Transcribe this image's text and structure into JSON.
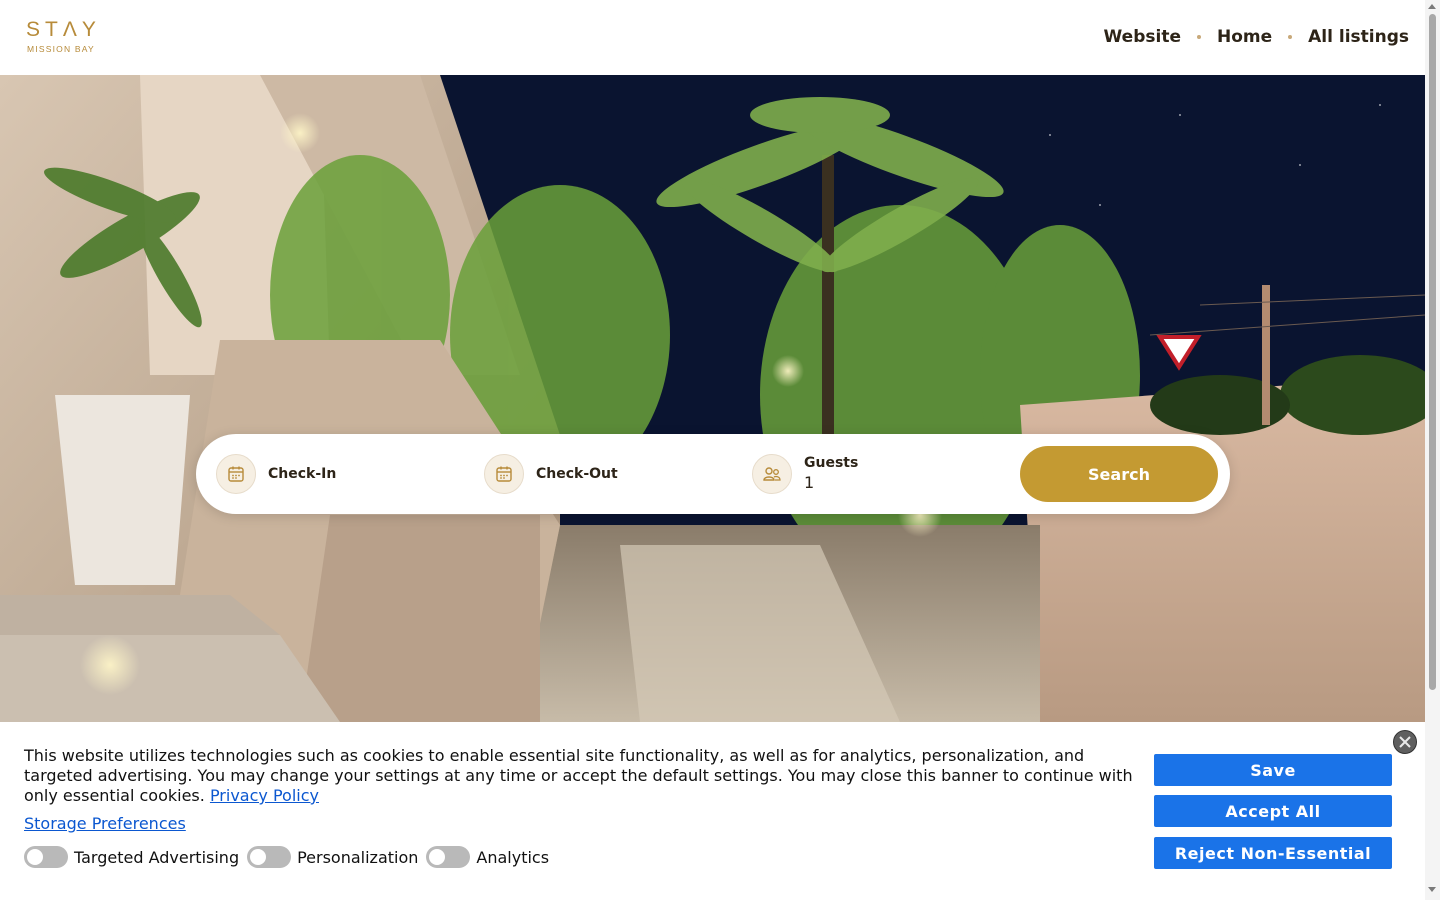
{
  "header": {
    "logo_main": "STΛY",
    "logo_sub": "MISSION BAY",
    "nav": [
      {
        "label": "Website"
      },
      {
        "label": "Home"
      },
      {
        "label": "All listings"
      }
    ]
  },
  "search": {
    "checkin_label": "Check-In",
    "checkout_label": "Check-Out",
    "guests_label": "Guests",
    "guests_value": "1",
    "search_button": "Search"
  },
  "cookie_banner": {
    "text": "This website utilizes technologies such as cookies to enable essential site functionality, as well as for analytics, personalization, and targeted advertising. You may change your settings at any time or accept the default settings. You may close this banner to continue with only essential cookies.",
    "privacy_link": "Privacy Policy",
    "storage_link": "Storage Preferences",
    "toggles": [
      {
        "label": "Targeted Advertising",
        "on": false
      },
      {
        "label": "Personalization",
        "on": false
      },
      {
        "label": "Analytics",
        "on": false
      }
    ],
    "buttons": {
      "save": "Save",
      "accept_all": "Accept All",
      "reject": "Reject Non-Essential"
    }
  },
  "colors": {
    "brand_gold": "#c49a32",
    "logo_gold": "#b78b3a",
    "cookie_button_blue": "#1a73e8",
    "link_blue": "#0b57d0"
  },
  "icons": [
    "calendar-icon",
    "calendar-icon",
    "guests-icon",
    "close-icon"
  ]
}
